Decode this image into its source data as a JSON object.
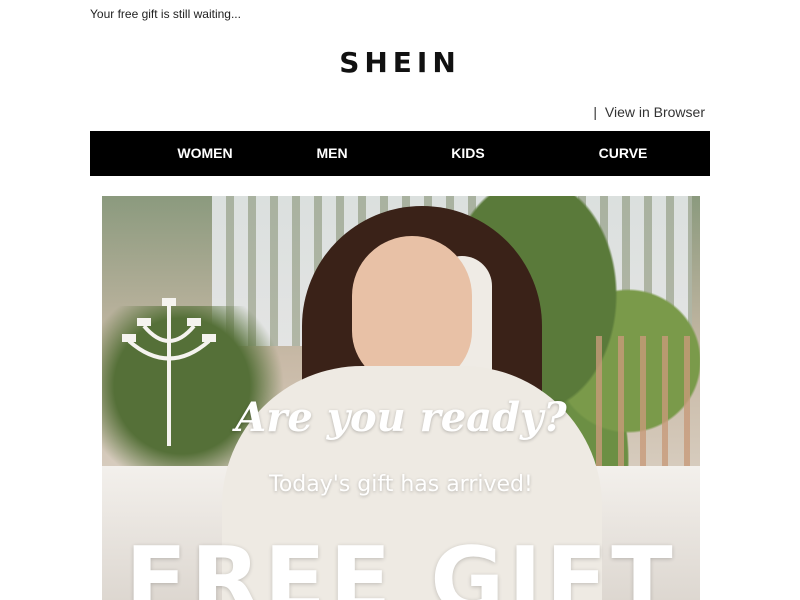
{
  "preheader": "Your free gift is still waiting...",
  "logo": "SHEIN",
  "top_links": {
    "separator": "|",
    "view_in_browser": "View in Browser"
  },
  "nav": [
    {
      "label": "WOMEN"
    },
    {
      "label": "MEN"
    },
    {
      "label": "KIDS"
    },
    {
      "label": "CURVE"
    }
  ],
  "hero": {
    "headline": "Are you ready?",
    "subline": "Today's gift has arrived!",
    "bigtext": "FREE GIFT"
  },
  "colors": {
    "nav_background": "#000000",
    "nav_text": "#ffffff",
    "hero_text": "#ffffff"
  }
}
